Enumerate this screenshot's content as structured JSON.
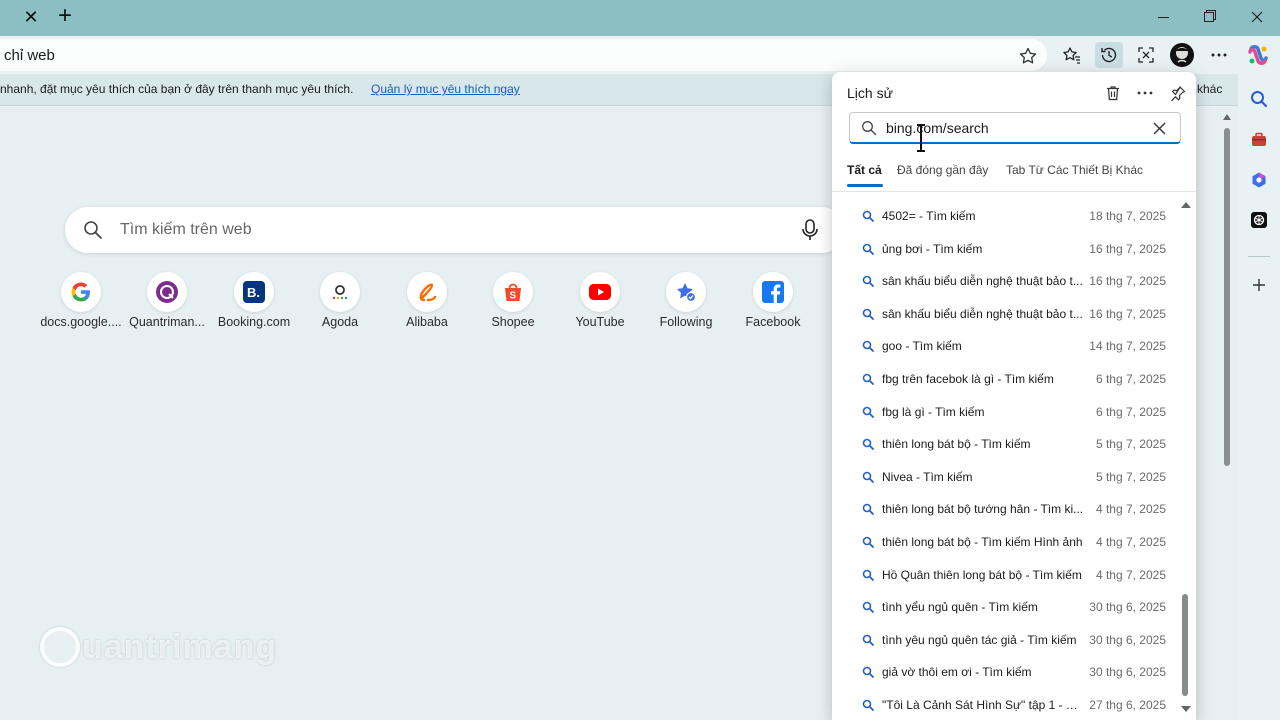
{
  "tabstrip": {
    "close_glyph": "✕",
    "new_tab_glyph": "+"
  },
  "omnibox": {
    "text": "chỉ web"
  },
  "infobar": {
    "text": "nhanh, đặt mục yêu thích của bạn ở đây trên thanh mục yêu thích.",
    "link": "Quản lý mục yêu thích ngay",
    "other": "khác"
  },
  "new_tab_page": {
    "search_placeholder": "Tìm kiếm trên web",
    "tiles": [
      {
        "label": "docs.google....",
        "icon": "google-icon"
      },
      {
        "label": "Quantriman...",
        "icon": "quantrimang-icon"
      },
      {
        "label": "Booking.com",
        "icon": "booking-icon"
      },
      {
        "label": "Agoda",
        "icon": "agoda-icon"
      },
      {
        "label": "Alibaba",
        "icon": "alibaba-icon"
      },
      {
        "label": "Shopee",
        "icon": "shopee-icon"
      },
      {
        "label": "YouTube",
        "icon": "youtube-icon"
      },
      {
        "label": "Following",
        "icon": "following-icon"
      },
      {
        "label": "Facebook",
        "icon": "facebook-icon"
      }
    ],
    "watermark": "uantrimang"
  },
  "history": {
    "title": "Lịch sử",
    "search_value": "bing.com/search",
    "tabs": [
      {
        "label": "Tất cả",
        "active": true
      },
      {
        "label": "Đã đóng gần đây",
        "active": false
      },
      {
        "label": "Tab Từ Các Thiết Bị Khác",
        "active": false
      }
    ],
    "items": [
      {
        "title": "4502= - Tìm kiếm",
        "date": "18 thg 7, 2025"
      },
      {
        "title": "ủng bơi - Tìm kiếm",
        "date": "16 thg 7, 2025"
      },
      {
        "title": "sân khấu biểu diễn nghệ thuật bảo t...",
        "date": "16 thg 7, 2025"
      },
      {
        "title": "sân khấu biểu diễn nghệ thuật bảo t...",
        "date": "16 thg 7, 2025"
      },
      {
        "title": "goo - Tìm kiếm",
        "date": "14 thg 7, 2025"
      },
      {
        "title": "fbg trên facebok là gì - Tìm kiếm",
        "date": "6 thg 7, 2025"
      },
      {
        "title": "fbg là gì - Tìm kiếm",
        "date": "6 thg 7, 2025"
      },
      {
        "title": "thiên long bát bộ - Tìm kiếm",
        "date": "5 thg 7, 2025"
      },
      {
        "title": "Nivea - Tìm kiếm",
        "date": "5 thg 7, 2025"
      },
      {
        "title": "thiên long bát bộ tướng hân - Tìm ki...",
        "date": "4 thg 7, 2025"
      },
      {
        "title": "thiên long bát bộ - Tìm kiếm Hình ảnh",
        "date": "4 thg 7, 2025"
      },
      {
        "title": "Hồ Quân thiên long bát bộ - Tìm kiếm",
        "date": "4 thg 7, 2025"
      },
      {
        "title": "tình yểu ngủ quên - Tìm kiếm",
        "date": "30 thg 6, 2025"
      },
      {
        "title": "tình yêu ngủ quên tác giả - Tìm kiếm",
        "date": "30 thg 6, 2025"
      },
      {
        "title": "giả vờ thôi em ơi - Tìm kiếm",
        "date": "30 thg 6, 2025"
      },
      {
        "title": "\"Tôi Là Cảnh Sát Hình Sự\" tập 1 - Tì...",
        "date": "27 thg 6, 2025"
      }
    ]
  },
  "colors": {
    "tabstrip": "#8bbfc3",
    "page_bg": "#e6f0f3",
    "accent": "#0f6cbd"
  }
}
